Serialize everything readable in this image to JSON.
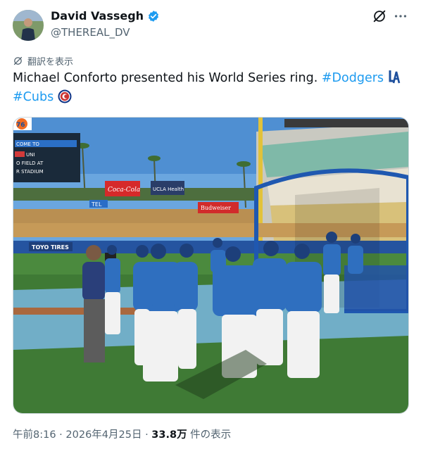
{
  "author": {
    "display_name": "David Vassegh",
    "handle": "@THEREAL_DV"
  },
  "translate_label": "翻訳を表示",
  "tweet": {
    "text": "Michael Conforto presented his World Series ring.",
    "hashtag_1": "#Dodgers",
    "hashtag_2": "#Cubs"
  },
  "photo": {
    "scoreboard_lines": [
      "COME TO",
      "UNI",
      "O FIELD AT",
      "R STADIUM"
    ],
    "sign_coca_cola": "Coca-Cola",
    "sign_ucla": "UCLA Health",
    "sign_budweiser": "Budweiser",
    "sign_tel": "TEL",
    "sign_toyo": "TOYO TIRES",
    "sign_76": "76"
  },
  "meta": {
    "time": "午前8:16",
    "separator": " · ",
    "date": "2026年4月25日",
    "views": "33.8万",
    "views_suffix": " 件の表示"
  },
  "colors": {
    "accent": "#1d9bf0",
    "dodger_blue": "#2f6fbf",
    "sky": "#5b9ad6",
    "grass": "#3f7a35"
  },
  "icons": [
    "verified-badge-icon",
    "grok-icon",
    "more-icon",
    "translate-icon",
    "la-logo-icon",
    "cubs-logo-icon"
  ]
}
